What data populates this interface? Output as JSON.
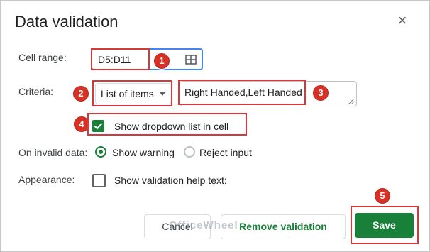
{
  "dialog": {
    "title": "Data validation",
    "close_glyph": "×"
  },
  "cell_range": {
    "label": "Cell range:",
    "value": "D5:D11",
    "icon": "grid-select-icon"
  },
  "criteria": {
    "label": "Criteria:",
    "type": "List of items",
    "items_value": "Right Handed,Left Handed",
    "show_dropdown_label": "Show dropdown list in cell",
    "show_dropdown_checked": true
  },
  "invalid_data": {
    "label": "On invalid data:",
    "options": [
      "Show warning",
      "Reject input"
    ],
    "selected": "Show warning"
  },
  "appearance": {
    "label": "Appearance:",
    "help_text_label": "Show validation help text:",
    "help_text_checked": false
  },
  "buttons": {
    "cancel": "Cancel",
    "remove": "Remove validation",
    "save": "Save"
  },
  "annotations": [
    "1",
    "2",
    "3",
    "4",
    "5"
  ],
  "watermark": "OfficeWheel",
  "colors": {
    "accent_green": "#188038",
    "focus_blue": "#4285f4",
    "highlight_red": "#d9383a"
  }
}
